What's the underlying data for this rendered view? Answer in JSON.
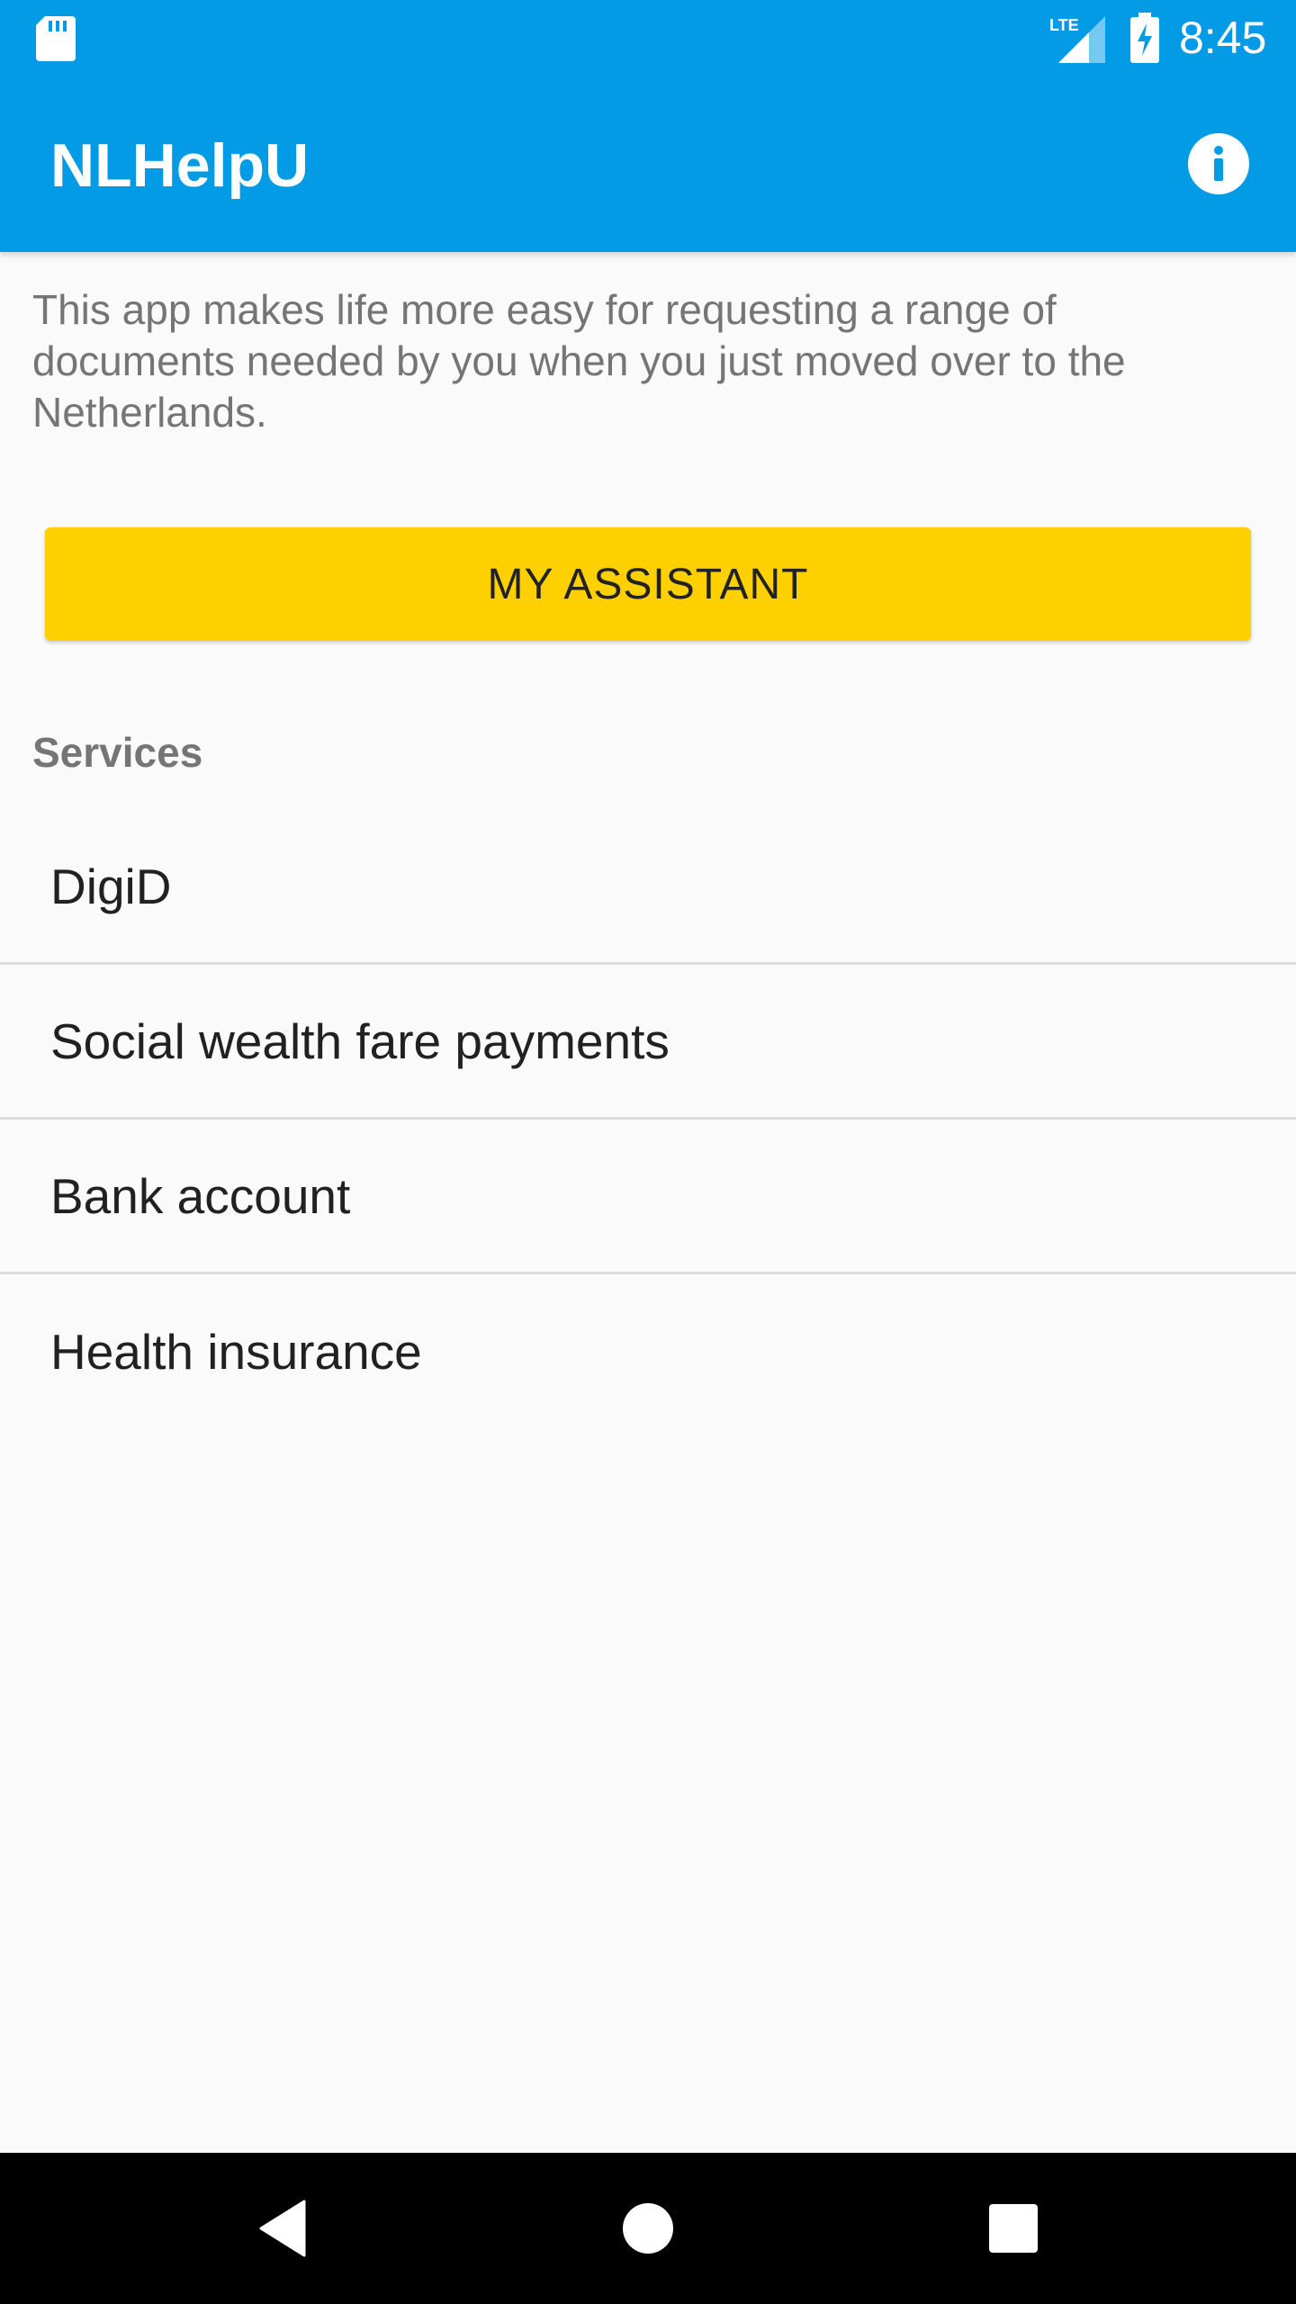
{
  "status_bar": {
    "time": "8:45",
    "network": "LTE",
    "icons": [
      "sd-card-icon",
      "lte-signal-icon",
      "battery-charging-icon"
    ]
  },
  "app_bar": {
    "title": "NLHelpU",
    "info_icon": "info-icon"
  },
  "main": {
    "intro_text": "This app makes life more easy for requesting a range of documents needed by you when you just moved over to the Netherlands.",
    "assistant_button_label": "MY ASSISTANT",
    "services_header": "Services",
    "services": [
      {
        "label": "DigiD"
      },
      {
        "label": "Social wealth fare payments"
      },
      {
        "label": "Bank account"
      },
      {
        "label": "Health insurance"
      }
    ]
  },
  "navigation": {
    "icons": [
      "back-icon",
      "home-icon",
      "recent-apps-icon"
    ]
  },
  "colors": {
    "primary": "#039be5",
    "accent_button": "#ffd000",
    "background": "#fafafa",
    "nav_bar": "#000000"
  }
}
